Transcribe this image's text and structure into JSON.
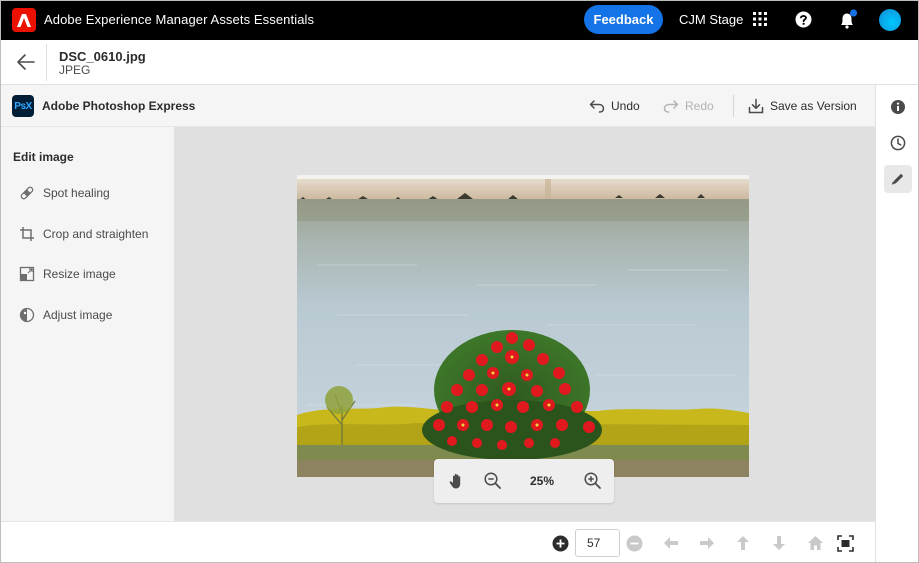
{
  "shell": {
    "app_title": "Adobe Experience Manager Assets Essentials",
    "feedback_label": "Feedback",
    "org_name": "CJM Stage",
    "brand_color": "#eb1000",
    "accent_color": "#1473e6",
    "icons": [
      "adobe-logo-icon",
      "apps-grid-icon",
      "help-icon",
      "bell-icon",
      "avatar"
    ]
  },
  "asset": {
    "name": "DSC_0610.jpg",
    "type": "JPEG"
  },
  "editor": {
    "logo_text": "PsX",
    "title": "Adobe Photoshop Express",
    "undo_label": "Undo",
    "redo_label": "Redo",
    "save_version_label": "Save as Version"
  },
  "left_panel": {
    "title": "Edit image",
    "tools": [
      {
        "label": "Spot healing",
        "icon": "bandage-icon"
      },
      {
        "label": "Crop and straighten",
        "icon": "crop-icon"
      },
      {
        "label": "Resize image",
        "icon": "resize-icon"
      },
      {
        "label": "Adjust image",
        "icon": "adjust-icon"
      }
    ]
  },
  "right_rail": {
    "items": [
      "info-icon",
      "history-icon",
      "edit-icon"
    ],
    "active": "edit-icon"
  },
  "zoom": {
    "level": "25%"
  },
  "pager": {
    "page_value": "57"
  }
}
